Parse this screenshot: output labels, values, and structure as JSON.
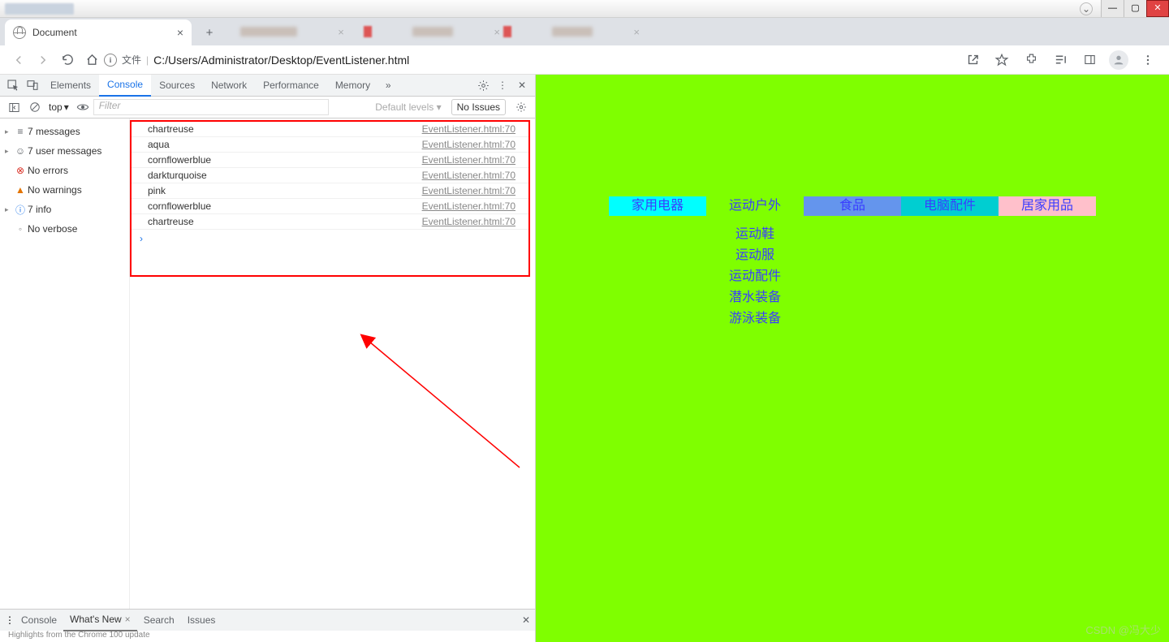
{
  "browser": {
    "tab_title": "Document",
    "url_label": "文件",
    "url": "C:/Users/Administrator/Desktop/EventListener.html"
  },
  "devtools": {
    "tabs": {
      "elements": "Elements",
      "console": "Console",
      "sources": "Sources",
      "network": "Network",
      "performance": "Performance",
      "memory": "Memory"
    },
    "toolbar": {
      "context": "top",
      "filter_ph": "Filter",
      "levels": "Default levels",
      "no_issues": "No Issues"
    },
    "sidebar": {
      "messages": "7 messages",
      "user": "7 user messages",
      "errors": "No errors",
      "warnings": "No warnings",
      "info": "7 info",
      "verbose": "No verbose"
    },
    "logs": [
      {
        "msg": "chartreuse",
        "src": "EventListener.html:70"
      },
      {
        "msg": "aqua",
        "src": "EventListener.html:70"
      },
      {
        "msg": "cornflowerblue",
        "src": "EventListener.html:70"
      },
      {
        "msg": "darkturquoise",
        "src": "EventListener.html:70"
      },
      {
        "msg": "pink",
        "src": "EventListener.html:70"
      },
      {
        "msg": "cornflowerblue",
        "src": "EventListener.html:70"
      },
      {
        "msg": "chartreuse",
        "src": "EventListener.html:70"
      }
    ],
    "drawer": {
      "console": "Console",
      "whatsnew": "What's New",
      "search": "Search",
      "issues": "Issues"
    }
  },
  "page": {
    "nav": [
      {
        "label": "家用电器"
      },
      {
        "label": "运动户外"
      },
      {
        "label": "食品"
      },
      {
        "label": "电脑配件"
      },
      {
        "label": "居家用品"
      }
    ],
    "sub": [
      "运动鞋",
      "运动服",
      "运动配件",
      "潜水装备",
      "游泳装备"
    ]
  },
  "watermark": "CSDN @冯大少"
}
